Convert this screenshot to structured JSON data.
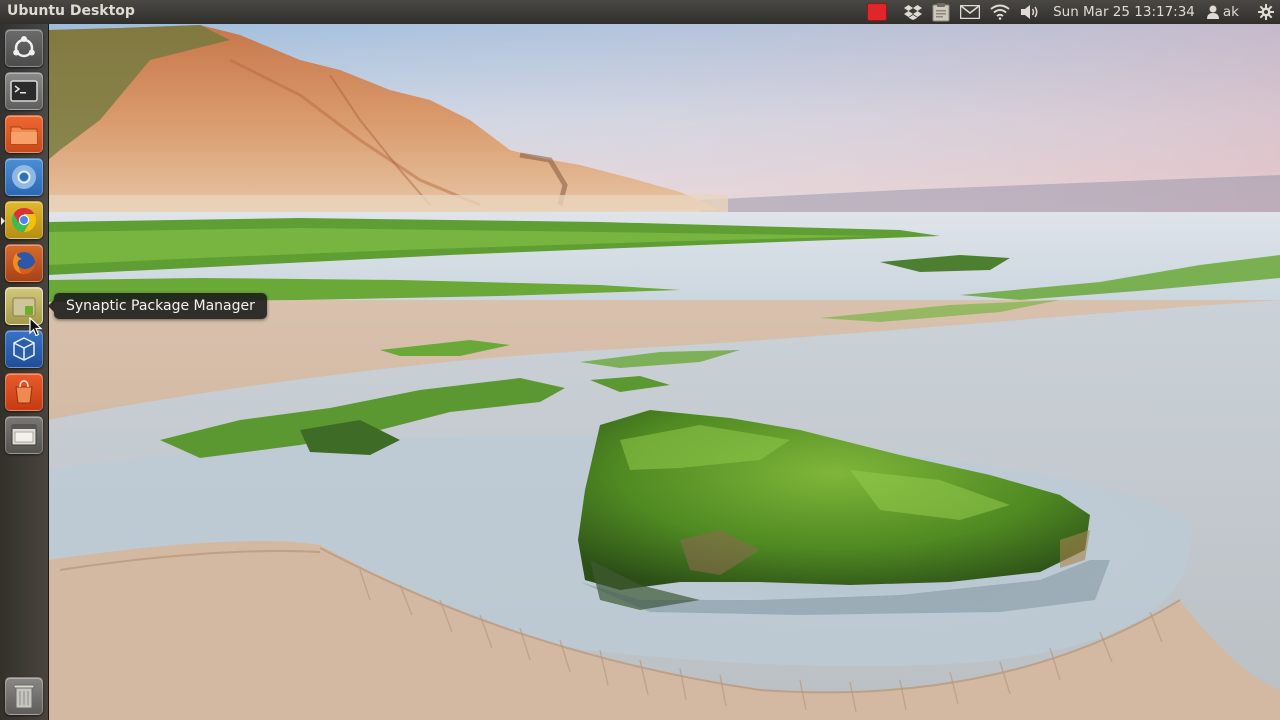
{
  "top_panel": {
    "title": "Ubuntu Desktop",
    "indicators": {
      "clock": "Sun Mar 25 13:17:34",
      "user": "ak"
    }
  },
  "launcher": {
    "items": [
      {
        "name": "dash-home",
        "icon": "ubuntu-logo-icon"
      },
      {
        "name": "terminal",
        "icon": "terminal-icon"
      },
      {
        "name": "files",
        "icon": "folder-icon"
      },
      {
        "name": "chromium",
        "icon": "chromium-icon"
      },
      {
        "name": "chrome",
        "icon": "chrome-icon"
      },
      {
        "name": "firefox",
        "icon": "firefox-icon"
      },
      {
        "name": "synaptic",
        "icon": "synaptic-icon"
      },
      {
        "name": "virtualbox",
        "icon": "virtualbox-icon"
      },
      {
        "name": "software-center",
        "icon": "software-center-icon"
      },
      {
        "name": "workspace-switcher",
        "icon": "workspace-switcher-icon"
      },
      {
        "name": "trash",
        "icon": "trash-icon"
      }
    ],
    "tooltip": "Synaptic Package Manager"
  },
  "colors": {
    "panel": "#3c3b37",
    "launcher": "#2f2d2a",
    "tooltip_bg": "#191919",
    "record_indicator": "#e0262a"
  }
}
